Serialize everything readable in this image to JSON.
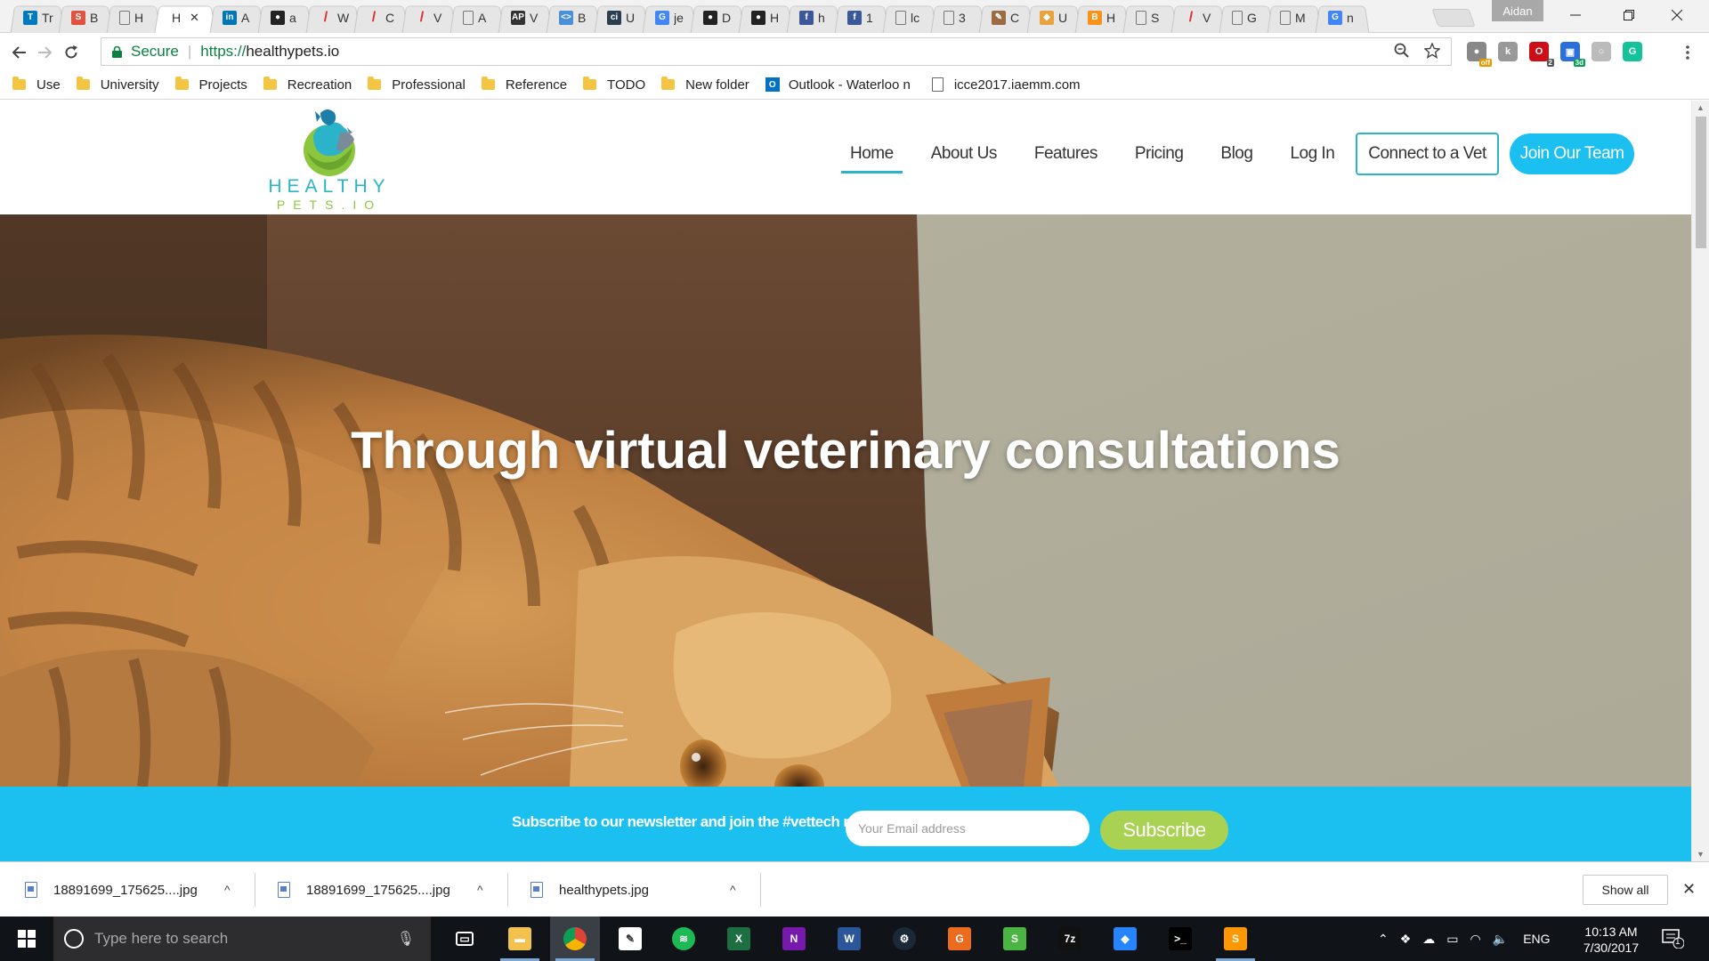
{
  "browser": {
    "tabs": [
      {
        "title": "Tr",
        "favicon": "trello-icon",
        "color": "#0079bf",
        "glyph": "T"
      },
      {
        "title": "B",
        "favicon": "scribd-icon",
        "color": "#e0523f",
        "glyph": "S"
      },
      {
        "title": "H",
        "favicon": "page-icon",
        "color": "#999999",
        "glyph": ""
      },
      {
        "title": "H",
        "favicon": "none",
        "color": "transparent",
        "glyph": "",
        "active": true,
        "close": "✕"
      },
      {
        "title": "A",
        "favicon": "linkedin-icon",
        "color": "#0077b5",
        "glyph": "in"
      },
      {
        "title": "a",
        "favicon": "github-icon",
        "color": "#222222",
        "glyph": "●"
      },
      {
        "title": "W",
        "favicon": "slash-icon",
        "color": "#d93025",
        "glyph": "/"
      },
      {
        "title": "C",
        "favicon": "slash-icon",
        "color": "#d93025",
        "glyph": "/"
      },
      {
        "title": "V",
        "favicon": "slash-icon",
        "color": "#d93025",
        "glyph": "/"
      },
      {
        "title": "A",
        "favicon": "page-icon",
        "color": "#999999",
        "glyph": ""
      },
      {
        "title": "V",
        "favicon": "ap-icon",
        "color": "#333333",
        "glyph": "AP"
      },
      {
        "title": "B",
        "favicon": "code-icon",
        "color": "#4a90d9",
        "glyph": "<>"
      },
      {
        "title": "U",
        "favicon": "ci-icon",
        "color": "#2b3e50",
        "glyph": "ci"
      },
      {
        "title": "je",
        "favicon": "google-icon",
        "color": "#4285f4",
        "glyph": "G"
      },
      {
        "title": "D",
        "favicon": "github-icon",
        "color": "#222222",
        "glyph": "●"
      },
      {
        "title": "H",
        "favicon": "github-icon",
        "color": "#222222",
        "glyph": "●"
      },
      {
        "title": "h",
        "favicon": "facebook-icon",
        "color": "#3b5998",
        "glyph": "f"
      },
      {
        "title": "1",
        "favicon": "facebook-icon",
        "color": "#3b5998",
        "glyph": "f"
      },
      {
        "title": "lc",
        "favicon": "page-icon",
        "color": "#999999",
        "glyph": ""
      },
      {
        "title": "3",
        "favicon": "page-icon",
        "color": "#999999",
        "glyph": ""
      },
      {
        "title": "C",
        "favicon": "pen-icon",
        "color": "#9b6b43",
        "glyph": "✎"
      },
      {
        "title": "U",
        "favicon": "shield-icon",
        "color": "#e8a33d",
        "glyph": "◆"
      },
      {
        "title": "H",
        "favicon": "bitcoin-icon",
        "color": "#f7931a",
        "glyph": "B"
      },
      {
        "title": "S",
        "favicon": "page-icon",
        "color": "#999999",
        "glyph": ""
      },
      {
        "title": "V",
        "favicon": "slash-icon",
        "color": "#d93025",
        "glyph": "/"
      },
      {
        "title": "G",
        "favicon": "page-icon",
        "color": "#999999",
        "glyph": ""
      },
      {
        "title": "M",
        "favicon": "page-icon",
        "color": "#999999",
        "glyph": ""
      },
      {
        "title": "n",
        "favicon": "google-icon",
        "color": "#4285f4",
        "glyph": "G"
      }
    ],
    "profile_name": "Aidan",
    "address": {
      "secure_label": "Secure",
      "protocol": "https://",
      "host": "healthypets.io"
    },
    "extensions": [
      {
        "name": "adblock-icon",
        "color": "#888888",
        "glyph": "●",
        "badge": "off"
      },
      {
        "name": "extension-k-icon",
        "color": "#999999",
        "glyph": "k"
      },
      {
        "name": "opera-icon",
        "color": "#cc0f16",
        "glyph": "O",
        "badge": "2"
      },
      {
        "name": "screen-icon",
        "color": "#2a6fdb",
        "glyph": "▣",
        "badge": "3d"
      },
      {
        "name": "circle-extension-icon",
        "color": "#bbbbbb",
        "glyph": "○"
      },
      {
        "name": "grammarly-icon",
        "color": "#15c39a",
        "glyph": "G"
      }
    ],
    "bookmarks": [
      {
        "type": "folder",
        "label": "Use"
      },
      {
        "type": "folder",
        "label": "University"
      },
      {
        "type": "folder",
        "label": "Projects"
      },
      {
        "type": "folder",
        "label": "Recreation"
      },
      {
        "type": "folder",
        "label": "Professional"
      },
      {
        "type": "folder",
        "label": "Reference"
      },
      {
        "type": "folder",
        "label": "TODO"
      },
      {
        "type": "folder",
        "label": "New folder"
      },
      {
        "type": "outlook",
        "label": "Outlook - Waterloo n"
      },
      {
        "type": "page",
        "label": "icce2017.iaemm.com"
      }
    ]
  },
  "site": {
    "logo_line1": "HEALTHY",
    "logo_line2": "PETS.IO",
    "nav": [
      {
        "label": "Home",
        "active": true
      },
      {
        "label": "About Us"
      },
      {
        "label": "Features"
      },
      {
        "label": "Pricing"
      },
      {
        "label": "Blog"
      },
      {
        "label": "Log In"
      }
    ],
    "connect_label": "Connect to a Vet",
    "join_label": "Join Our Team",
    "hero_title": "Through virtual veterinary consultations",
    "newsletter": {
      "text": "Subscribe to our newsletter and join the #vettech revolution!",
      "placeholder": "Your Email address",
      "button": "Subscribe"
    },
    "colors": {
      "accent": "#1bc0f0",
      "green": "#a9d152",
      "teal": "#2ab3c9"
    }
  },
  "downloads": {
    "items": [
      {
        "filename": "18891699_175625....jpg"
      },
      {
        "filename": "18891699_175625....jpg"
      },
      {
        "filename": "healthypets.jpg"
      }
    ],
    "show_all": "Show all"
  },
  "taskbar": {
    "search_placeholder": "Type here to search",
    "apps": [
      {
        "name": "task-view-icon",
        "color": "transparent",
        "glyph": "▭"
      },
      {
        "name": "file-explorer-icon",
        "color": "#f2c14e",
        "glyph": "▬",
        "running": true
      },
      {
        "name": "chrome-icon",
        "color": "#db4437",
        "glyph": "◉",
        "running": true,
        "focused": true
      },
      {
        "name": "editor-icon",
        "color": "#ffffff",
        "glyph": "✎"
      },
      {
        "name": "spotify-icon",
        "color": "#1db954",
        "glyph": "≋"
      },
      {
        "name": "excel-icon",
        "color": "#1d6f42",
        "glyph": "X"
      },
      {
        "name": "onenote-icon",
        "color": "#7719aa",
        "glyph": "N"
      },
      {
        "name": "word-icon",
        "color": "#2b579a",
        "glyph": "W"
      },
      {
        "name": "steam-icon",
        "color": "#1b2838",
        "glyph": "⚙"
      },
      {
        "name": "office-icon",
        "color": "#eb6c1f",
        "glyph": "G"
      },
      {
        "name": "sublime-alt-icon",
        "color": "#4bb543",
        "glyph": "S"
      },
      {
        "name": "7zip-icon",
        "color": "#111111",
        "glyph": "7z"
      },
      {
        "name": "sourcetree-icon",
        "color": "#2684ff",
        "glyph": "◆"
      },
      {
        "name": "terminal-icon",
        "color": "#000000",
        "glyph": ">_"
      },
      {
        "name": "sublime-icon",
        "color": "#ff9800",
        "glyph": "S",
        "running": true
      }
    ],
    "language": "ENG",
    "time": "10:13 AM",
    "date": "7/30/2017",
    "notification_count": "1"
  }
}
